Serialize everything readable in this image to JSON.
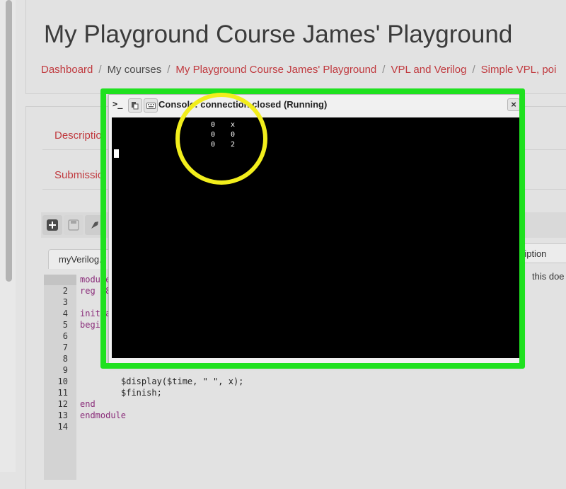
{
  "page": {
    "title": "My Playground Course James' Playground",
    "breadcrumb": [
      {
        "label": "Dashboard"
      },
      {
        "label": "My courses"
      },
      {
        "label": "My Playground Course James' Playground"
      },
      {
        "label": "VPL and Verilog"
      },
      {
        "label": "Simple VPL, poi"
      }
    ]
  },
  "tabs": {
    "description": "Descriptio",
    "submission": "Submissio"
  },
  "editor": {
    "file_tab": "myVerilog.v",
    "description_tab": "ription",
    "description_text": "this doe",
    "line_numbers": [
      "1",
      "2",
      "3",
      "4",
      "5",
      "6",
      "7",
      "8",
      "9",
      "10",
      "11",
      "12",
      "13",
      "14"
    ],
    "visible_code": {
      "l1": "module",
      "l2": "reg [8",
      "l4": "initia",
      "l5": "begi",
      "l10": "$display($time, \" \", x);",
      "l11": "$finish;",
      "l12": "end",
      "l13": "endmodule"
    }
  },
  "console": {
    "prompt_icon": ">_",
    "title": "Console: connection closed (Running)",
    "close_label": "×",
    "output": [
      {
        "time": "0",
        "value": "x"
      },
      {
        "time": "0",
        "value": "0"
      },
      {
        "time": "0",
        "value": "2"
      }
    ]
  },
  "colors": {
    "link": "#c0393e",
    "annotation_frame": "#1fe11f",
    "annotation_circle": "#f2ee1c",
    "terminal_bg": "#000000"
  }
}
